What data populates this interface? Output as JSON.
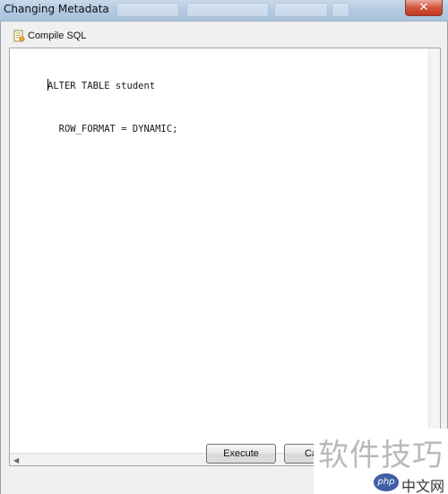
{
  "window": {
    "title": "Changing Metadata",
    "close_glyph": "✕"
  },
  "toolbar": {
    "compile_label": "Compile SQL",
    "compile_icon": "compile-sql-icon"
  },
  "editor": {
    "lines": [
      "ALTER TABLE student",
      "  ROW_FORMAT = DYNAMIC;"
    ]
  },
  "buttons": {
    "execute_label": "Execute",
    "cancel_label": "Ca"
  },
  "watermark": {
    "text": "软件技巧",
    "brand": "php",
    "site": "中文网"
  }
}
